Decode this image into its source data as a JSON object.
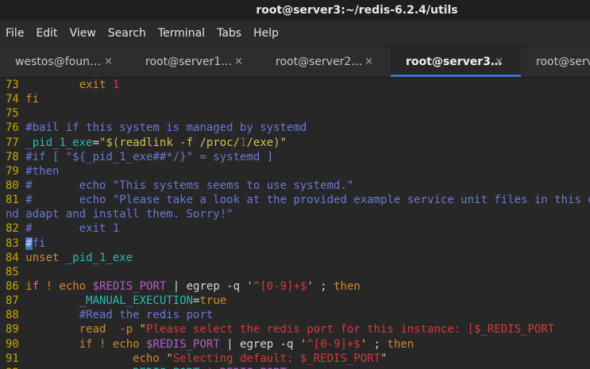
{
  "window": {
    "title": "root@server3:~/redis-6.2.4/utils"
  },
  "menu": [
    "File",
    "Edit",
    "View",
    "Search",
    "Terminal",
    "Tabs",
    "Help"
  ],
  "tabs": [
    {
      "label": "westos@foun…",
      "active": false,
      "close_icon": "×"
    },
    {
      "label": "root@server1…",
      "active": false,
      "close_icon": "×"
    },
    {
      "label": "root@server2…",
      "active": false,
      "close_icon": "×"
    },
    {
      "label": "root@server3…",
      "active": true,
      "close_icon": "×"
    },
    {
      "label": "root@serv",
      "active": false,
      "close_icon": ""
    }
  ],
  "colors": {
    "background": "#272727",
    "accent": "#3a73c9",
    "line_number": "#c6a800"
  },
  "terminal_lines": [
    [
      [
        "ln",
        "73 "
      ],
      [
        "pl",
        "        "
      ],
      [
        "or",
        "exit "
      ],
      [
        "rd",
        "1"
      ]
    ],
    [
      [
        "ln",
        "74 "
      ],
      [
        "or",
        "fi"
      ]
    ],
    [
      [
        "ln",
        "75 "
      ]
    ],
    [
      [
        "ln",
        "76 "
      ],
      [
        "cm",
        "#bail if this system is managed by systemd"
      ]
    ],
    [
      [
        "ln",
        "77 "
      ],
      [
        "vr",
        "_pid_1_exe"
      ],
      [
        "pl",
        "="
      ],
      [
        "st",
        "\"$(readlink -f /proc/"
      ],
      [
        "rd",
        "1"
      ],
      [
        "st",
        "/exe)\""
      ]
    ],
    [
      [
        "ln",
        "78 "
      ],
      [
        "cm",
        "#if [ \"${_pid_1_exe##*/}\" = systemd ]"
      ]
    ],
    [
      [
        "ln",
        "79 "
      ],
      [
        "cm",
        "#then"
      ]
    ],
    [
      [
        "ln",
        "80 "
      ],
      [
        "cm",
        "#       echo \"This systems seems to use systemd.\""
      ]
    ],
    [
      [
        "ln",
        "81 "
      ],
      [
        "cm",
        "#       echo \"Please take a look at the provided example service unit files in this directory, a"
      ]
    ],
    [
      [
        "cm",
        "nd adapt and install them. Sorry!\""
      ]
    ],
    [
      [
        "ln",
        "82 "
      ],
      [
        "cm",
        "#       exit 1"
      ]
    ],
    [
      [
        "ln",
        "83 "
      ],
      [
        "cu",
        "#"
      ],
      [
        "cm",
        "fi"
      ]
    ],
    [
      [
        "ln",
        "84 "
      ],
      [
        "or",
        "unset "
      ],
      [
        "vr",
        "_pid_1_exe"
      ]
    ],
    [
      [
        "ln",
        "85 "
      ]
    ],
    [
      [
        "ln",
        "86 "
      ],
      [
        "or",
        "if ! "
      ],
      [
        "or",
        "echo "
      ],
      [
        "pu",
        "$REDIS_PORT"
      ],
      [
        "pl",
        " | egrep -q "
      ],
      [
        "st",
        "'"
      ],
      [
        "rd",
        "^[0-9]+$"
      ],
      [
        "st",
        "'"
      ],
      [
        "pl",
        " ; "
      ],
      [
        "or",
        "then"
      ]
    ],
    [
      [
        "ln",
        "87 "
      ],
      [
        "pl",
        "        "
      ],
      [
        "vr",
        "_MANUAL_EXECUTION"
      ],
      [
        "pl",
        "="
      ],
      [
        "or",
        "true"
      ]
    ],
    [
      [
        "ln",
        "88 "
      ],
      [
        "pl",
        "        "
      ],
      [
        "cm",
        "#Read the redis port"
      ]
    ],
    [
      [
        "ln",
        "89 "
      ],
      [
        "pl",
        "        "
      ],
      [
        "or",
        "read  -p "
      ],
      [
        "st",
        "\""
      ],
      [
        "rd",
        "Please select the redis port for this instance: [$_REDIS_PORT"
      ]
    ],
    [
      [
        "ln",
        "90 "
      ],
      [
        "pl",
        "        "
      ],
      [
        "or",
        "if ! "
      ],
      [
        "or",
        "echo "
      ],
      [
        "pu",
        "$REDIS_PORT"
      ],
      [
        "pl",
        " | egrep -q "
      ],
      [
        "st",
        "'"
      ],
      [
        "rd",
        "^[0-9]+$"
      ],
      [
        "st",
        "'"
      ],
      [
        "pl",
        " ; "
      ],
      [
        "or",
        "then"
      ]
    ],
    [
      [
        "ln",
        "91 "
      ],
      [
        "pl",
        "                "
      ],
      [
        "or",
        "echo "
      ],
      [
        "st",
        "\""
      ],
      [
        "rd",
        "Selecting default: $_REDIS_PORT"
      ],
      [
        "st",
        "\""
      ]
    ],
    [
      [
        "ln",
        "92 "
      ],
      [
        "pl",
        "                "
      ],
      [
        "vr",
        "REDIS_PORT"
      ],
      [
        "pl",
        "="
      ],
      [
        "pu",
        "$_REDIS_PORT"
      ]
    ]
  ]
}
